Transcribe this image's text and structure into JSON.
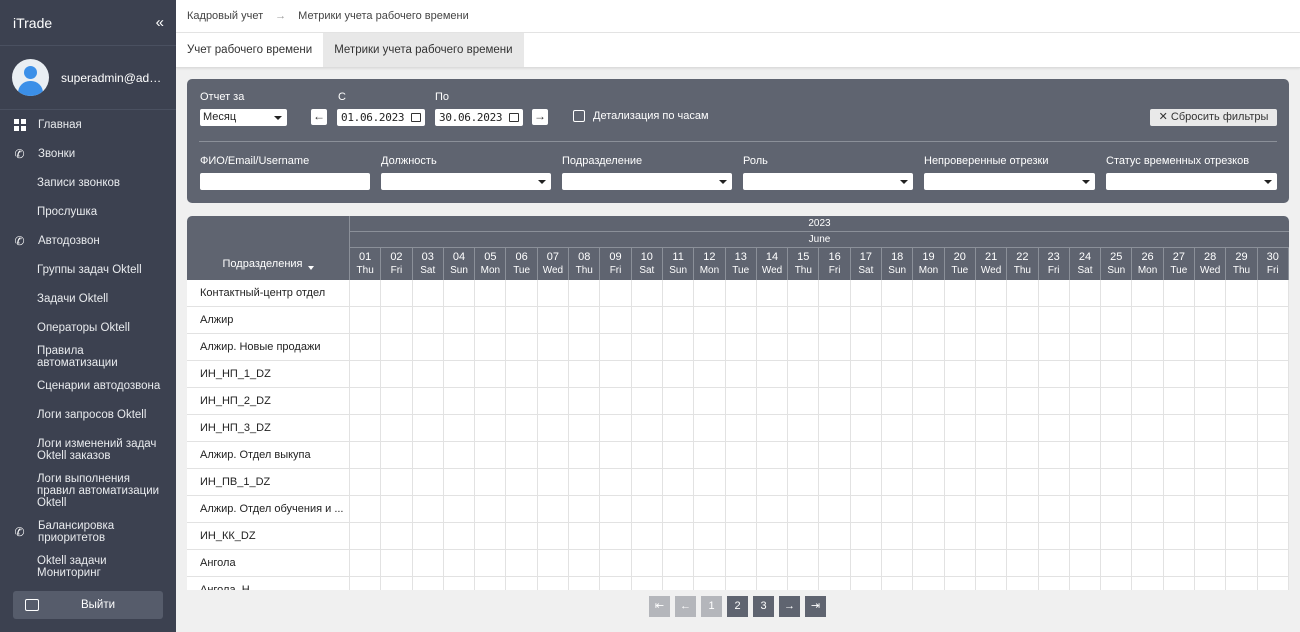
{
  "sidebar": {
    "app_title": "iTrade",
    "collapse_glyph": "«",
    "username": "superadmin@admi...",
    "items": [
      {
        "label": "Главная",
        "icon": "dashboard-icon",
        "level": "top"
      },
      {
        "label": "Звонки",
        "icon": "phone-icon",
        "level": "top"
      },
      {
        "label": "Записи звонков",
        "level": "sub"
      },
      {
        "label": "Прослушка",
        "level": "sub"
      },
      {
        "label": "Автодозвон",
        "icon": "phone-icon",
        "level": "top"
      },
      {
        "label": "Группы задач Oktell",
        "level": "sub"
      },
      {
        "label": "Задачи Oktell",
        "level": "sub"
      },
      {
        "label": "Операторы Oktell",
        "level": "sub"
      },
      {
        "label": "Правила автоматизации",
        "level": "sub"
      },
      {
        "label": "Сценарии автодозвона",
        "level": "sub"
      },
      {
        "label": "Логи запросов Oktell",
        "level": "sub"
      },
      {
        "label": "Логи изменений задач Oktell заказов",
        "level": "sub"
      },
      {
        "label": "Логи выполнения правил автоматизации Oktell",
        "level": "sub"
      },
      {
        "label": "Балансировка приоритетов",
        "icon": "phone-icon",
        "level": "top"
      },
      {
        "label": "Oktell задачи Мониторинг",
        "level": "sub"
      }
    ],
    "logout_label": "Выйти"
  },
  "breadcrumb": {
    "items": [
      "Кадровый учет",
      "Метрики учета рабочего времени"
    ],
    "separator": "→"
  },
  "tabs": [
    {
      "label": "Учет рабочего времени",
      "active": false
    },
    {
      "label": "Метрики учета рабочего времени",
      "active": true
    }
  ],
  "filters": {
    "report_label": "Отчет за",
    "report_value": "Месяц",
    "from_label": "С",
    "from_value": "01.06.2023",
    "to_label": "По",
    "to_value": "30.06.2023",
    "hourly_label": "Детализация по часам",
    "reset_label": "Сбросить фильтры",
    "fio_label": "ФИО/Email/Username",
    "position_label": "Должность",
    "department_label": "Подразделение",
    "role_label": "Роль",
    "unverified_label": "Непроверенные отрезки",
    "status_label": "Статус временных отрезков"
  },
  "table": {
    "dept_header": "Подразделения",
    "year": "2023",
    "month": "June",
    "days": [
      {
        "d": "01",
        "w": "Thu"
      },
      {
        "d": "02",
        "w": "Fri"
      },
      {
        "d": "03",
        "w": "Sat"
      },
      {
        "d": "04",
        "w": "Sun"
      },
      {
        "d": "05",
        "w": "Mon"
      },
      {
        "d": "06",
        "w": "Tue"
      },
      {
        "d": "07",
        "w": "Wed"
      },
      {
        "d": "08",
        "w": "Thu"
      },
      {
        "d": "09",
        "w": "Fri"
      },
      {
        "d": "10",
        "w": "Sat"
      },
      {
        "d": "11",
        "w": "Sun"
      },
      {
        "d": "12",
        "w": "Mon"
      },
      {
        "d": "13",
        "w": "Tue"
      },
      {
        "d": "14",
        "w": "Wed"
      },
      {
        "d": "15",
        "w": "Thu"
      },
      {
        "d": "16",
        "w": "Fri"
      },
      {
        "d": "17",
        "w": "Sat"
      },
      {
        "d": "18",
        "w": "Sun"
      },
      {
        "d": "19",
        "w": "Mon"
      },
      {
        "d": "20",
        "w": "Tue"
      },
      {
        "d": "21",
        "w": "Wed"
      },
      {
        "d": "22",
        "w": "Thu"
      },
      {
        "d": "23",
        "w": "Fri"
      },
      {
        "d": "24",
        "w": "Sat"
      },
      {
        "d": "25",
        "w": "Sun"
      },
      {
        "d": "26",
        "w": "Mon"
      },
      {
        "d": "27",
        "w": "Tue"
      },
      {
        "d": "28",
        "w": "Wed"
      },
      {
        "d": "29",
        "w": "Thu"
      },
      {
        "d": "30",
        "w": "Fri"
      }
    ],
    "rows": [
      "Контактный-центр отдел",
      "Алжир",
      "Алжир. Новые продажи",
      "ИН_НП_1_DZ",
      "ИН_НП_2_DZ",
      "ИН_НП_3_DZ",
      "Алжир. Отдел выкупа",
      "ИН_ПВ_1_DZ",
      "Алжир. Отдел обучения и ...",
      "ИН_КК_DZ",
      "Ангола",
      "Ангола. Н..."
    ]
  },
  "pagination": {
    "first": "⇤",
    "prev": "←",
    "pages": [
      "1",
      "2",
      "3"
    ],
    "next": "→",
    "last": "⇥"
  }
}
